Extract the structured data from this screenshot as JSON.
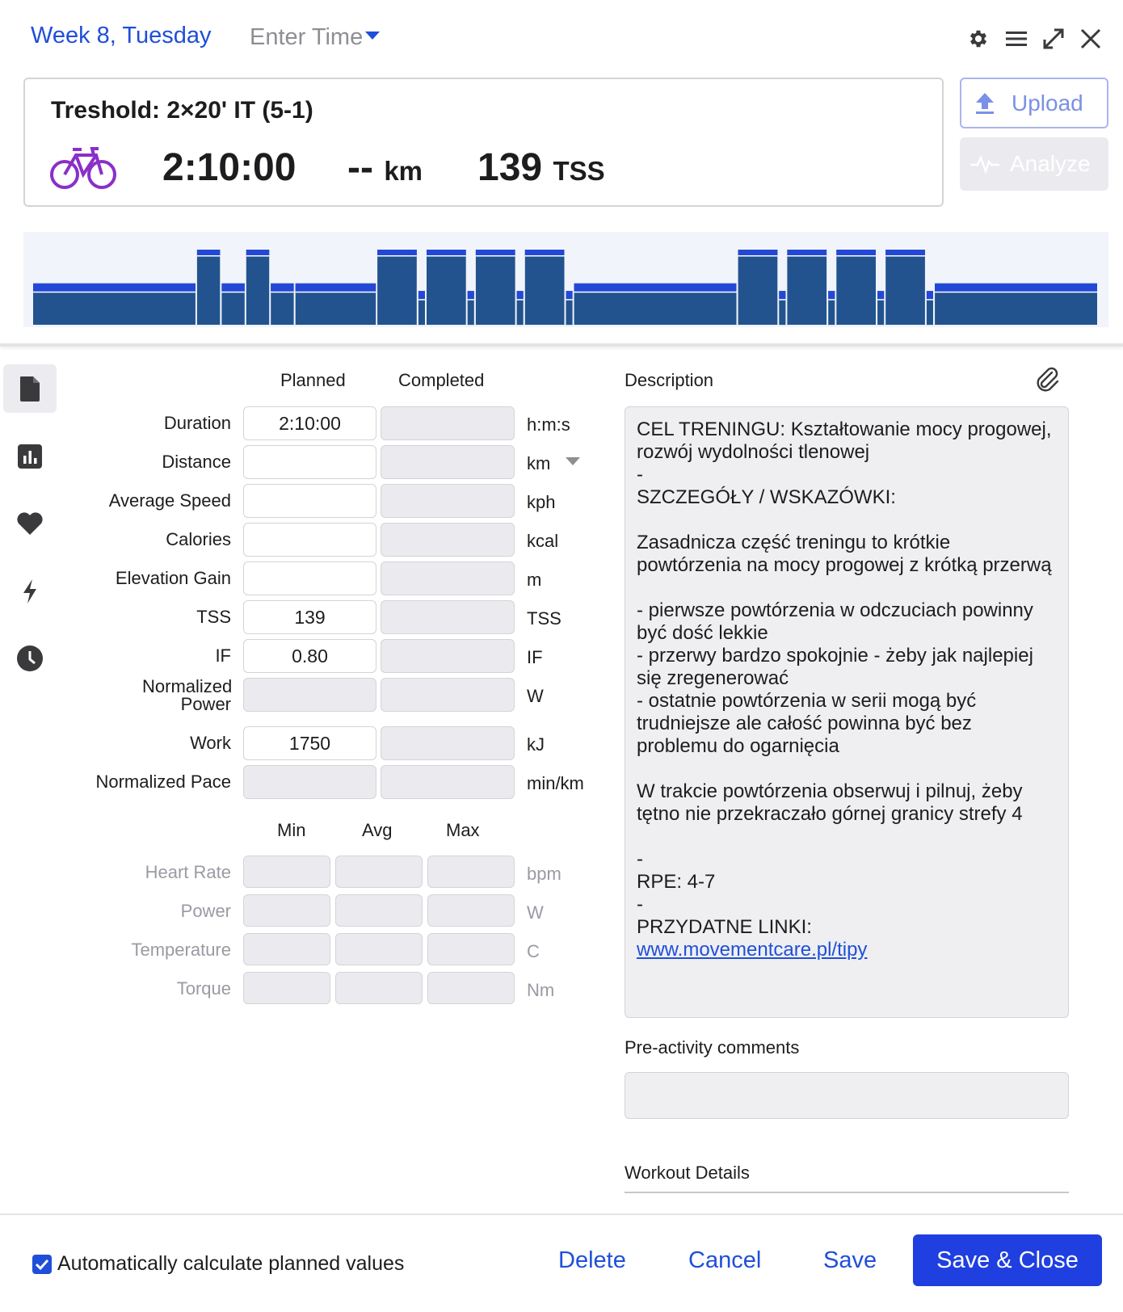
{
  "header": {
    "week_day": "Week 8, Tuesday",
    "enter_time": "Enter Time",
    "icons": [
      "gear-icon",
      "menu-icon",
      "expand-icon",
      "close-icon"
    ]
  },
  "summary": {
    "title": "Treshold: 2×20' IT (5-1)",
    "sport_icon": "bike-icon",
    "duration": "2:10:00",
    "distance": "--",
    "distance_unit": "km",
    "tss": "139",
    "tss_unit": "TSS",
    "upload_label": "Upload",
    "analyze_label": "Analyze"
  },
  "sidebar": {
    "icons": [
      "document-icon",
      "bar-chart-icon",
      "heart-icon",
      "lightning-icon",
      "clock-icon"
    ]
  },
  "form": {
    "planned_header": "Planned",
    "completed_header": "Completed",
    "rows": [
      {
        "label": "Duration",
        "planned": "2:10:00",
        "completed": "",
        "unit": "h:m:s"
      },
      {
        "label": "Distance",
        "planned": "",
        "completed": "",
        "unit": "km"
      },
      {
        "label": "Average Speed",
        "planned": "",
        "completed": "",
        "unit": "kph"
      },
      {
        "label": "Calories",
        "planned": "",
        "completed": "",
        "unit": "kcal"
      },
      {
        "label": "Elevation Gain",
        "planned": "",
        "completed": "",
        "unit": "m"
      },
      {
        "label": "TSS",
        "planned": "139",
        "completed": "",
        "unit": "TSS"
      },
      {
        "label": "IF",
        "planned": "0.80",
        "completed": "",
        "unit": "IF"
      },
      {
        "label": "Normalized Power",
        "planned": "",
        "completed": "",
        "unit": "W"
      },
      {
        "label": "Work",
        "planned": "1750",
        "completed": "",
        "unit": "kJ"
      },
      {
        "label": "Normalized Pace",
        "planned": "",
        "completed": "",
        "unit": "min/km"
      }
    ],
    "min_header": "Min",
    "avg_header": "Avg",
    "max_header": "Max",
    "range_rows": [
      {
        "label": "Heart Rate",
        "unit": "bpm"
      },
      {
        "label": "Power",
        "unit": "W"
      },
      {
        "label": "Temperature",
        "unit": "C"
      },
      {
        "label": "Torque",
        "unit": "Nm"
      }
    ]
  },
  "description": {
    "label": "Description",
    "text": "CEL TRENINGU: Kształtowanie mocy progowej, rozwój wydolności tlenowej\n-\nSZCZEGÓŁY / WSKAZÓWKI:\n\nZasadnicza część treningu to krótkie powtórzenia na mocy progowej z krótką przerwą\n\n- pierwsze powtórzenia w odczuciach powinny być dość lekkie\n- przerwy bardzo spokojnie - żeby jak najlepiej się zregenerować\n- ostatnie powtórzenia w serii mogą być trudniejsze ale całość powinna być bez problemu do ogarnięcia\n\nW trakcie powtórzenia obserwuj i pilnuj, żeby tętno nie przekraczało górnej granicy strefy 4\n\n-\nRPE: 4-7\n-\nPRZYDATNE LINKI:",
    "link": "www.movementcare.pl/tipy",
    "pre_activity_label": "Pre-activity comments",
    "workout_details_label": "Workout Details"
  },
  "footer": {
    "auto_calc_label": "Automatically calculate planned values",
    "auto_calc_checked": true,
    "delete_label": "Delete",
    "cancel_label": "Cancel",
    "save_label": "Save",
    "save_close_label": "Save & Close"
  },
  "workout_graph": {
    "segments": [
      {
        "duration": 20,
        "level": 0.55
      },
      {
        "duration": 3,
        "level": 1.0
      },
      {
        "duration": 3,
        "level": 0.55
      },
      {
        "duration": 3,
        "level": 1.0
      },
      {
        "duration": 3,
        "level": 0.55
      },
      {
        "duration": 10,
        "level": 0.55
      },
      {
        "duration": 5,
        "level": 1.0
      },
      {
        "duration": 1,
        "level": 0.45
      },
      {
        "duration": 5,
        "level": 1.0
      },
      {
        "duration": 1,
        "level": 0.45
      },
      {
        "duration": 5,
        "level": 1.0
      },
      {
        "duration": 1,
        "level": 0.45
      },
      {
        "duration": 5,
        "level": 1.0
      },
      {
        "duration": 1,
        "level": 0.45
      },
      {
        "duration": 20,
        "level": 0.55
      },
      {
        "duration": 5,
        "level": 1.0
      },
      {
        "duration": 1,
        "level": 0.45
      },
      {
        "duration": 5,
        "level": 1.0
      },
      {
        "duration": 1,
        "level": 0.45
      },
      {
        "duration": 5,
        "level": 1.0
      },
      {
        "duration": 1,
        "level": 0.45
      },
      {
        "duration": 5,
        "level": 1.0
      },
      {
        "duration": 1,
        "level": 0.45
      },
      {
        "duration": 20,
        "level": 0.55
      }
    ],
    "bar_color": "#22538f",
    "cap_color": "#2448d6"
  }
}
